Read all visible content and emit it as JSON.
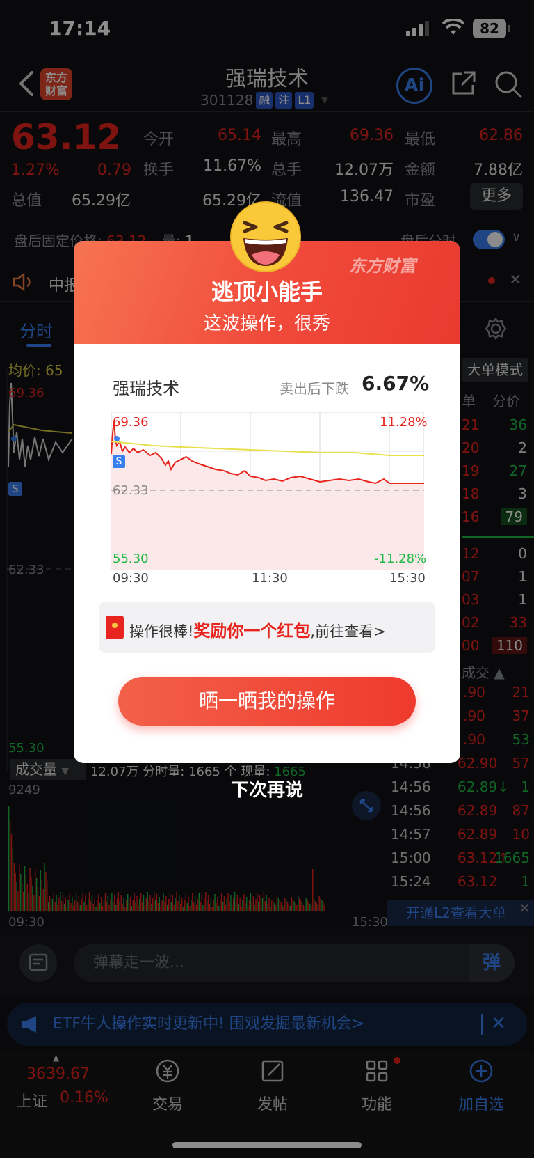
{
  "status_bar": {
    "time": "17:14",
    "battery": "82"
  },
  "header": {
    "logo_line1": "东方",
    "logo_line2": "财富",
    "title": "强瑞技术",
    "code": "301128",
    "tags": [
      "融",
      "注",
      "L1"
    ],
    "ai_label": "Ai"
  },
  "quote": {
    "price": "63.12",
    "change_pct": "1.27%",
    "change": "0.79",
    "fields": [
      {
        "label": "今开",
        "value": "65.14",
        "color": "#e8241e"
      },
      {
        "label": "最高",
        "value": "69.36",
        "color": "#e8241e"
      },
      {
        "label": "最低",
        "value": "62.86",
        "color": "#e8241e"
      },
      {
        "label": "换手",
        "value": "11.67%",
        "color": "#e8e8e8"
      },
      {
        "label": "总手",
        "value": "12.07万",
        "color": "#e8e8e8"
      },
      {
        "label": "金额",
        "value": "7.88亿",
        "color": "#e8e8e8"
      },
      {
        "label": "总值",
        "value": "65.29亿",
        "color": "#e8e8e8"
      },
      {
        "label": "流值",
        "value": "65.29亿",
        "color": "#e8e8e8"
      },
      {
        "label": "市盈",
        "value": "136.47",
        "color": "#e8e8e8"
      }
    ],
    "more_label": "更多"
  },
  "after_hours": {
    "label": "盘后固定价格:",
    "price": "63.12",
    "qty_label": "量:",
    "qty": "1",
    "right_label": "盘后分时"
  },
  "news": {
    "text": "中报"
  },
  "tabs": {
    "active": "分时"
  },
  "chart": {
    "avg_label": "均价: 65",
    "high": "69.36",
    "base": "62.33",
    "low": "55.30",
    "sell_marker": "S"
  },
  "right_panel": {
    "mode_button": "大单模式",
    "header_left": "单",
    "header_right": "分价",
    "orderbook": [
      {
        "p": "21",
        "v": "36"
      },
      {
        "p": "20",
        "v": "2"
      },
      {
        "p": "19",
        "v": "27"
      },
      {
        "p": "18",
        "v": "3"
      },
      {
        "p": "16",
        "v": "79"
      },
      {
        "p": "12",
        "v": "0"
      },
      {
        "p": "07",
        "v": "1"
      },
      {
        "p": "03",
        "v": "1"
      },
      {
        "p": "02",
        "v": "33"
      },
      {
        "p": "00",
        "v": "110"
      }
    ],
    "trades_header": "成交",
    "trades": [
      {
        "t": "",
        "p": ".90",
        "v": "21"
      },
      {
        "t": "",
        "p": ".90",
        "v": "37"
      },
      {
        "t": "",
        "p": ".90",
        "v": "53"
      },
      {
        "t": "14:56",
        "p": "62.90",
        "v": "57"
      },
      {
        "t": "14:56",
        "p": "62.89↓",
        "v": "1"
      },
      {
        "t": "14:56",
        "p": "62.89",
        "v": "87"
      },
      {
        "t": "14:57",
        "p": "62.89",
        "v": "10"
      },
      {
        "t": "15:00",
        "p": "63.12↑",
        "v": "1665"
      },
      {
        "t": "15:24",
        "p": "63.12",
        "v": "1"
      }
    ],
    "l2_banner": "开通L2查看大单"
  },
  "volume": {
    "label": "成交量",
    "info_total": "12.07万",
    "info_min_label": "分时量:",
    "info_min": "1665",
    "info_unit": "个",
    "info_cur_label": "现量:",
    "info_cur": "1665",
    "max": "9249",
    "time_start": "09:30",
    "time_end": "15:30"
  },
  "comment": {
    "placeholder": "弹幕走一波...",
    "send": "弹"
  },
  "etf_banner": {
    "text": "ETF牛人操作实时更新中! 围观发掘最新机会>"
  },
  "bottom_nav": {
    "index_price": "3639.67",
    "index_name": "上证",
    "index_pct": "0.16%",
    "items": [
      "交易",
      "发帖",
      "功能",
      "加自选"
    ]
  },
  "modal": {
    "brand": "东方财富",
    "title": "逃顶小能手",
    "subtitle": "这波操作，很秀",
    "stock": "强瑞技术",
    "drop_label": "卖出后下跌",
    "drop_value": "6.67%",
    "chart_high": "69.36",
    "chart_base": "62.33",
    "chart_low": "55.30",
    "chart_high_pct": "11.28%",
    "chart_low_pct": "-11.28%",
    "time_labels": [
      "09:30",
      "11:30",
      "15:30"
    ],
    "reward_prefix": "操作很棒!",
    "reward_highlight": "奖励你一个红包",
    "reward_suffix": ",前往查看>",
    "share_button": "晒一晒我的操作",
    "later": "下次再说"
  }
}
